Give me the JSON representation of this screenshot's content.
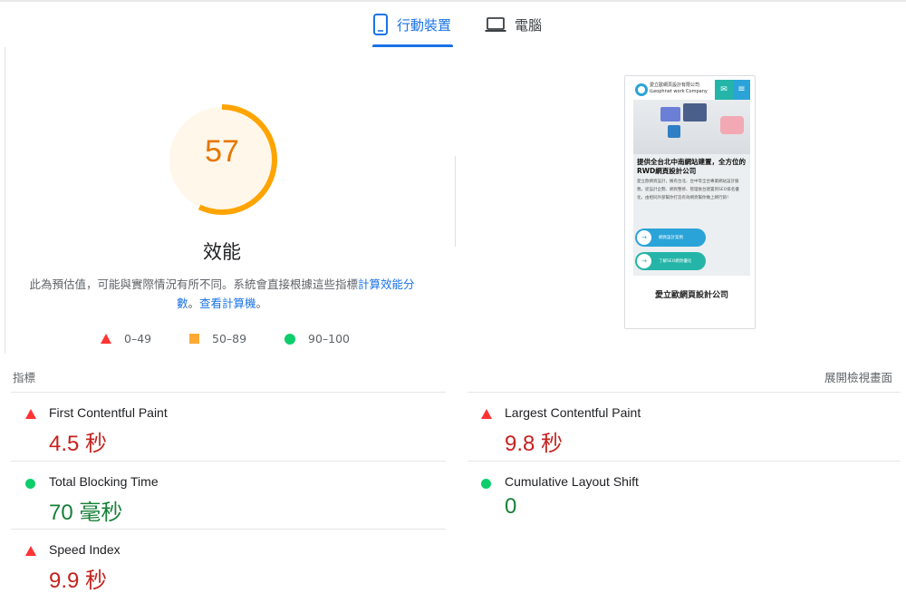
{
  "tabs": {
    "mobile": "行動裝置",
    "desktop": "電腦"
  },
  "score": {
    "value": "57",
    "fraction": 0.57,
    "title": "效能",
    "color": "#ffa400"
  },
  "description": {
    "text": "此為預估值，可能與實際情況有所不同。系統會直接根據這些指標",
    "link1": "計算效能分數",
    "sep": "。",
    "link2": "查看計算機",
    "end": "。"
  },
  "legend": {
    "fail": "0–49",
    "average": "50–89",
    "pass": "90–100"
  },
  "screenshot": {
    "company_name": "愛立歐網頁設計有限公司",
    "company_sub": "iLeophnet work Company",
    "headline": "提供全台北中南網站建置，全方位的RWD網頁設計公司",
    "paragraph": "愛立歐網頁設計，擁有台北、台中等全台專業網站設計服務。從設計企劃、網頁整修、管理後台建置到SEO排名優化，由相同外部幫你打造有效網頁幫你做上網行銷！",
    "button1": "網頁設計案例",
    "button2": "了解SEO網頁優化",
    "footer": "愛立歐網頁設計公司"
  },
  "metrics": {
    "title": "指標",
    "expand": "展開檢視畫面",
    "fcp": {
      "name": "First Contentful Paint",
      "value": "4.5 秒",
      "status": "fail"
    },
    "lcp": {
      "name": "Largest Contentful Paint",
      "value": "9.8 秒",
      "status": "fail"
    },
    "tbt": {
      "name": "Total Blocking Time",
      "value": "70 毫秒",
      "status": "pass"
    },
    "cls": {
      "name": "Cumulative Layout Shift",
      "value": "0",
      "status": "pass"
    },
    "si": {
      "name": "Speed Index",
      "value": "9.9 秒",
      "status": "fail"
    }
  },
  "colors": {
    "accent": "#1a73e8",
    "fail": "#ff3333",
    "average": "#ffaa33",
    "pass": "#0cce6b"
  }
}
